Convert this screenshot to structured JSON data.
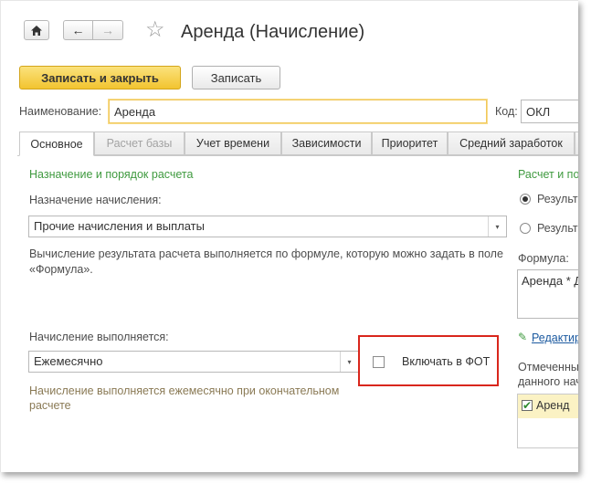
{
  "window": {
    "title": "Аренда (Начисление)"
  },
  "toolbar": {
    "save_close_label": "Записать и закрыть",
    "save_label": "Записать"
  },
  "form": {
    "name_label": "Наименование:",
    "name_value": "Аренда",
    "code_label": "Код:",
    "code_value": "ОКЛ"
  },
  "tabs": [
    {
      "label": "Основное",
      "state": "active"
    },
    {
      "label": "Расчет базы",
      "state": "disabled"
    },
    {
      "label": "Учет времени",
      "state": "normal"
    },
    {
      "label": "Зависимости",
      "state": "normal"
    },
    {
      "label": "Приоритет",
      "state": "normal"
    },
    {
      "label": "Средний заработок",
      "state": "normal"
    }
  ],
  "left": {
    "section_title": "Назначение и порядок расчета",
    "purpose_label": "Назначение начисления:",
    "purpose_value": "Прочие начисления и выплаты",
    "description": "Вычисление результата расчета выполняется по формуле, которую можно задать в поле «Формула».",
    "performed_label": "Начисление выполняется:",
    "performed_value": "Ежемесячно",
    "fot_checkbox_label": "Включать в ФОТ",
    "fot_checked": false,
    "note": "Начисление выполняется ежемесячно при окончательном расчете"
  },
  "right": {
    "section_title": "Расчет и пок",
    "radio1_label": "Результ",
    "radio2_label": "Результ",
    "formula_label": "Формула:",
    "formula_value": "Аренда * Д",
    "edit_link": "Редактир",
    "marked_text_line1": "Отмеченны",
    "marked_text_line2": "данного нач",
    "list_item": "Аренд"
  },
  "colors": {
    "accent_yellow": "#f2c430",
    "green_text": "#3f9a3f",
    "highlight_red": "#d9261c"
  }
}
